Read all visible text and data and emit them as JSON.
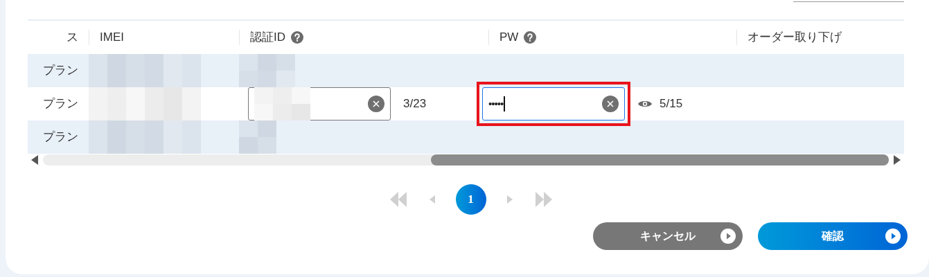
{
  "table": {
    "columns": [
      {
        "label": "ス",
        "help": false
      },
      {
        "label": "IMEI",
        "help": false
      },
      {
        "label": "認証ID",
        "help": true
      },
      {
        "label": "PW",
        "help": true
      },
      {
        "label": "オーダー取り下げ",
        "help": false
      }
    ],
    "rows": [
      {
        "plan": "プラン",
        "editing": false
      },
      {
        "plan": "プラン",
        "editing": true,
        "auth_id": {
          "count": "3/23",
          "focused": false,
          "highlighted": false,
          "reveal": false
        },
        "pw": {
          "value": "•••••",
          "count": "5/15",
          "focused": true,
          "highlighted": true,
          "reveal": true
        }
      },
      {
        "plan": "プラン",
        "editing": false
      }
    ]
  },
  "pagination": {
    "pages": [
      {
        "label": "1",
        "selected": true
      }
    ]
  },
  "buttons": [
    {
      "label": "キャンセル",
      "kind": "secondary"
    },
    {
      "label": "確認",
      "kind": "primary"
    }
  ]
}
